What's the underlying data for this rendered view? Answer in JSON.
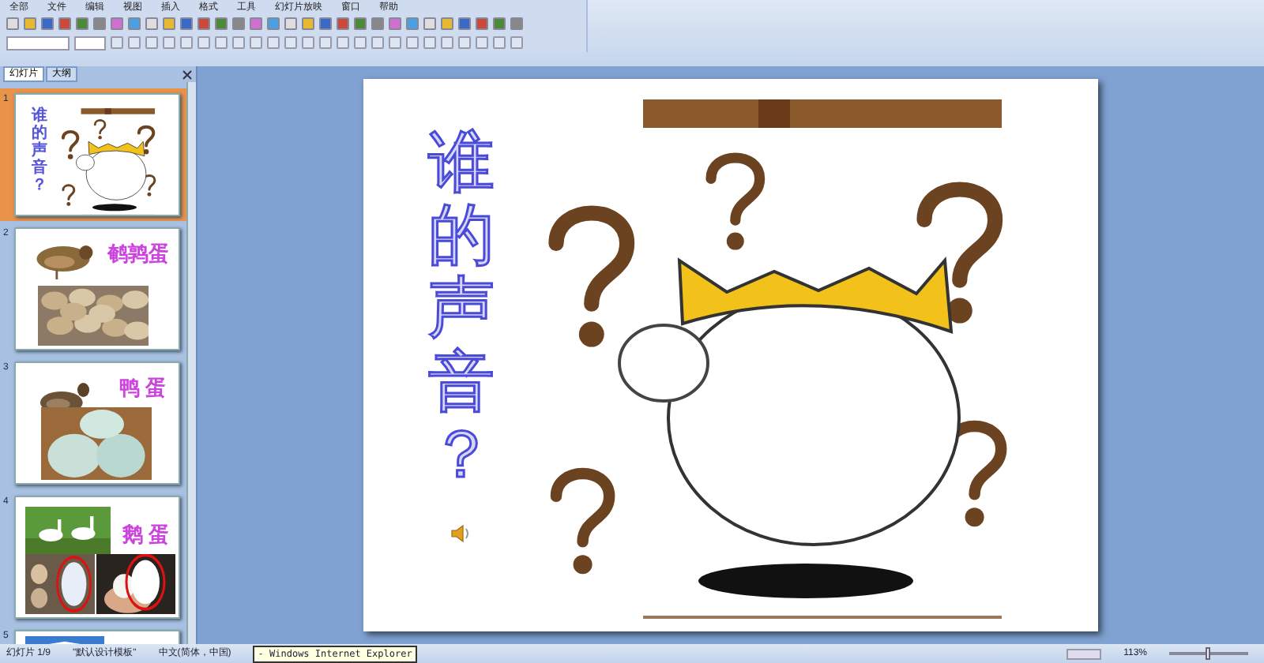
{
  "menu": [
    "全部",
    "文件",
    "编辑",
    "视图",
    "插入",
    "格式",
    "工具",
    "幻灯片放映",
    "窗口",
    "帮助"
  ],
  "panel_tabs": [
    {
      "label": "幻灯片",
      "selected": true
    },
    {
      "label": "大纲",
      "selected": false
    }
  ],
  "slides": [
    {
      "number": "1",
      "selected": true,
      "kind": "title",
      "title": "谁的声音？"
    },
    {
      "number": "2",
      "selected": false,
      "kind": "quail",
      "title": "鹌鹑蛋"
    },
    {
      "number": "3",
      "selected": false,
      "kind": "duck",
      "title": "鸭 蛋"
    },
    {
      "number": "4",
      "selected": false,
      "kind": "goose",
      "title": "鹅 蛋"
    },
    {
      "number": "5",
      "selected": false,
      "kind": "partial"
    }
  ],
  "slide": {
    "title": "谁的声音？"
  },
  "status_bar": {
    "slide_count": "幻灯片 1/9",
    "template": "\"默认设计模板\"",
    "language": "中文(简体，中国)",
    "zoom": "113%",
    "zoom_slider": {
      "level": 0.5
    }
  },
  "taskbar_tooltip": "- Windows Internet Explorer"
}
